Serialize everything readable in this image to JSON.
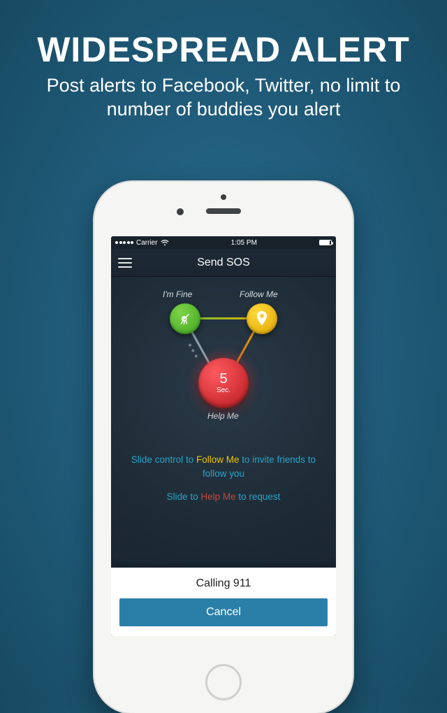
{
  "promo": {
    "title": "WIDESPREAD ALERT",
    "subtitle": "Post alerts to Facebook, Twitter, no limit to number of buddies you alert"
  },
  "statusbar": {
    "carrier": "Carrier",
    "time": "1:05 PM"
  },
  "navbar": {
    "title": "Send SOS"
  },
  "nodes": {
    "fine_label": "I'm Fine",
    "follow_label": "Follow Me",
    "help_label": "Help Me",
    "countdown_value": "5",
    "countdown_unit": "Sec."
  },
  "instructions": {
    "line1_pre": "Slide control to ",
    "line1_hl": "Follow Me",
    "line1_post": " to invite friends to follow you",
    "line2_pre": "Slide to ",
    "line2_hl": "Help Me",
    "line2_post": " to request"
  },
  "dialog": {
    "title": "Calling 911",
    "cancel": "Cancel"
  },
  "icons": {
    "hamburger": "menu-icon",
    "wifi": "wifi-icon",
    "battery": "battery-icon",
    "fine": "ok-hand-icon",
    "follow": "location-pin-icon"
  }
}
